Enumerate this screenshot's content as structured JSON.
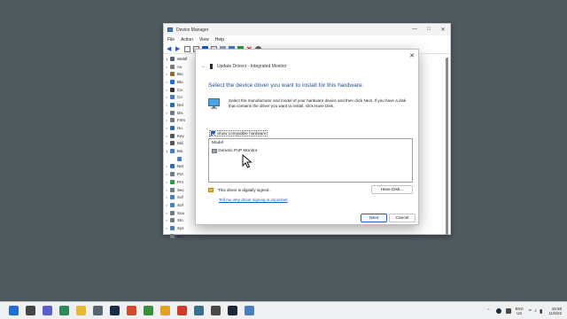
{
  "device_manager": {
    "title": "Device Manager",
    "menu": [
      "File",
      "Action",
      "View",
      "Help"
    ],
    "tree": [
      {
        "expander": "∨",
        "label": "Webfl",
        "color": "#5a6470"
      },
      {
        "expander": ">",
        "label": "Au",
        "color": "#7a7a7a"
      },
      {
        "expander": ">",
        "label": "Bio",
        "color": "#8a6d3b"
      },
      {
        "expander": ">",
        "label": "Blu",
        "color": "#1e6fd9"
      },
      {
        "expander": ">",
        "label": "Ca",
        "color": "#333333"
      },
      {
        "expander": ">",
        "label": "Co",
        "color": "#4a7fbf"
      },
      {
        "expander": ">",
        "label": "Del",
        "color": "#2d6ea8"
      },
      {
        "expander": ">",
        "label": "Dis",
        "color": "#6f7a84"
      },
      {
        "expander": ">",
        "label": "Firm",
        "color": "#6f7a84"
      },
      {
        "expander": ">",
        "label": "Hu",
        "color": "#2d6ea8"
      },
      {
        "expander": ">",
        "label": "Key",
        "color": "#555555"
      },
      {
        "expander": ">",
        "label": "Mic",
        "color": "#555555"
      },
      {
        "expander": "∨",
        "label": "Mo",
        "color": "#4a7fbf"
      },
      {
        "expander": "",
        "label": "",
        "color": "#4a7fbf"
      },
      {
        "expander": ">",
        "label": "Net",
        "color": "#2d6ea8"
      },
      {
        "expander": ">",
        "label": "Por",
        "color": "#6f7a84"
      },
      {
        "expander": ">",
        "label": "Pro",
        "color": "#2d9c4a"
      },
      {
        "expander": ">",
        "label": "Sec",
        "color": "#6f7a84"
      },
      {
        "expander": ">",
        "label": "Sof",
        "color": "#4a7fbf"
      },
      {
        "expander": ">",
        "label": "Sof",
        "color": "#4a7fbf"
      },
      {
        "expander": ">",
        "label": "Sou",
        "color": "#6f7a84"
      },
      {
        "expander": ">",
        "label": "Sto",
        "color": "#6f7a84"
      },
      {
        "expander": ">",
        "label": "Sys",
        "color": "#4a7fbf"
      },
      {
        "expander": ">",
        "label": "Uni",
        "color": "#6f7a84"
      }
    ]
  },
  "dialog": {
    "header": "Update Drivers - Integrated Monitor",
    "heading": "Select the device driver you want to install for this hardware.",
    "description": "Select the manufacturer and model of your hardware device and then click Next. If you have a disk that contains the driver you want to install, click Have Disk.",
    "show_compatible": "Show compatible hardware",
    "list_header": "Model",
    "models": [
      "Generic PnP Monitor"
    ],
    "signed_text": "This driver is digitally signed.",
    "signing_link": "Tell me why driver signing is important",
    "have_disk": "Have Disk...",
    "next": "Next",
    "cancel": "Cancel"
  },
  "taskbar": {
    "apps": [
      {
        "name": "windows-start-icon",
        "color": "#1f6fd9"
      },
      {
        "name": "search-icon",
        "color": "#444444"
      },
      {
        "name": "chat-icon",
        "color": "#5b5fc7"
      },
      {
        "name": "camtasia-icon",
        "color": "#2e8b57"
      },
      {
        "name": "file-explorer-icon",
        "color": "#e8b830"
      },
      {
        "name": "settings-icon",
        "color": "#5a6470"
      },
      {
        "name": "powershell-icon",
        "color": "#1a2a4a"
      },
      {
        "name": "chrome-icon",
        "color": "#d9472b"
      },
      {
        "name": "chrome-beta-icon",
        "color": "#3a8f3a"
      },
      {
        "name": "chrome-canary-icon",
        "color": "#e6a11a"
      },
      {
        "name": "snip-icon",
        "color": "#d2392b"
      },
      {
        "name": "steam-settings-icon",
        "color": "#3b6e8f"
      },
      {
        "name": "gear-icon",
        "color": "#4a4a4a"
      },
      {
        "name": "steam-icon",
        "color": "#1b2838"
      },
      {
        "name": "device-manager-icon",
        "color": "#4a7fbf"
      }
    ],
    "language": [
      "ENG",
      "US"
    ],
    "time": "15:58",
    "date": "11/5/22"
  }
}
